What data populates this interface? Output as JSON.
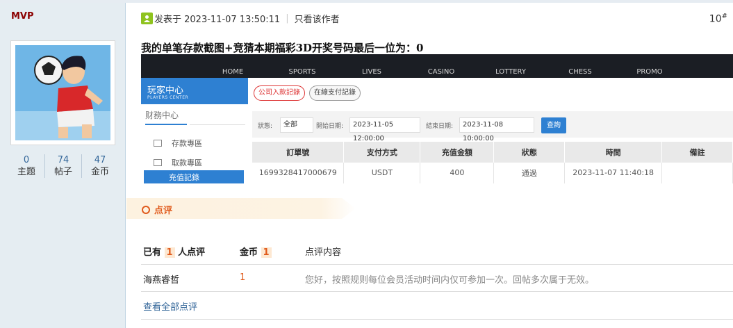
{
  "user": {
    "name": "MVP",
    "stats": [
      {
        "value": "0",
        "label": "主题"
      },
      {
        "value": "74",
        "label": "帖子"
      },
      {
        "value": "47",
        "label": "金币"
      }
    ]
  },
  "post": {
    "posted_at": "发表于 2023-11-07 13:50:11",
    "only_author": "只看该作者",
    "floor": "10",
    "floor_mark": "#",
    "title": "我的单笔存款截图+竞猜本期福彩3D开奖号码最后一位为：0"
  },
  "screenshot": {
    "nav": [
      "HOME",
      "SPORTS",
      "LIVES",
      "CASINO",
      "LOTTERY",
      "CHESS",
      "PROMO"
    ],
    "side_title": "玩家中心",
    "side_subtitle": "PLAYERS CENTER",
    "side_category": "财務中心",
    "side_items": [
      "存款專區",
      "取款專區"
    ],
    "side_active": "充值記錄",
    "tabs": [
      "公司入款記錄",
      "在線支付記錄"
    ],
    "filter": {
      "status_label": "狀態:",
      "status_value": "全部",
      "start_label": "開始日期:",
      "start_value": "2023-11-05 12:00:00",
      "end_label": "結束日期:",
      "end_value": "2023-11-08 10:00:00",
      "query_button": "查詢"
    },
    "table": {
      "headers": [
        "訂單號",
        "支付方式",
        "充值金額",
        "狀態",
        "時間",
        "備註"
      ],
      "row": [
        "1699328417000679",
        "USDT",
        "400",
        "通過",
        "2023-11-07 11:40:18",
        ""
      ]
    }
  },
  "comments": {
    "section_title": "点评",
    "count_prefix": "已有",
    "count": "1",
    "count_suffix": "人点评",
    "coins_label": "金币",
    "coins_total": "1",
    "content_label": "点评内容",
    "rows": [
      {
        "user": "海燕睿哲",
        "coins": "1",
        "content": "您好，按照规则每位会员活动时间内仅可参加一次。回帖多次属于无效。"
      }
    ],
    "view_all": "查看全部点评"
  },
  "colors": {
    "username": "#8b0000",
    "link": "#336699",
    "accent": "#e05a1b",
    "sidebar_bg": "#e5edf2"
  }
}
